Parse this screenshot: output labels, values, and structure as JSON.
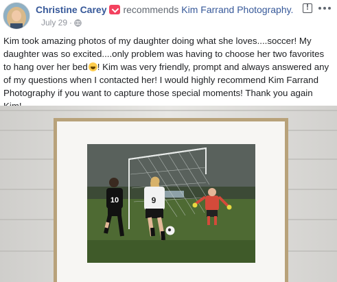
{
  "post": {
    "author": "Christine Carey",
    "verb": "recommends",
    "page_name": "Kim Farrand Photography.",
    "date": "July 29",
    "separator": "·",
    "text_before_emoji": "Kim took amazing photos of my daughter doing what she loves....soccer! My daughter was so excited....only problem was having to choose her two favorites to hang over her bed",
    "text_after_emoji": "! Kim was very friendly, prompt and always answered any of my questions when I contacted her! I would highly recommend Kim Farrand Photography if you want to capture those special moments! Thank you again Kim!",
    "jersey_numbers": [
      "10",
      "9"
    ]
  },
  "icons": {
    "recommend": "recommend-badge-icon",
    "privacy": "globe-icon",
    "emoji": "laughing-emoji-icon",
    "report": "report-flag-icon",
    "more": "more-options-icon"
  },
  "colors": {
    "link": "#365899",
    "secondary_text": "#90949c",
    "recommend_badge": "#f3425f"
  }
}
